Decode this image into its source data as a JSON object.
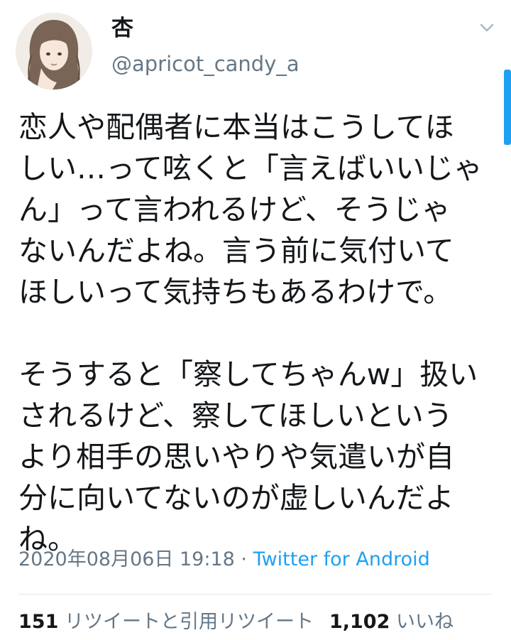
{
  "author": {
    "display_name": "杏",
    "handle": "@apricot_candy_a"
  },
  "tweet": {
    "lines_p1": [
      "恋人や配偶者に本当はこうしてほ",
      "しい…って呟くと「言えばいいじゃ",
      "ん」って言われるけど、そうじゃ",
      "ないんだよね。言う前に気付いて",
      "ほしいって気持ちもあるわけで。"
    ],
    "lines_p2": [
      "そうすると「察してちゃんw」扱い",
      "されるけど、察してほしいという",
      "より相手の思いやりや気遣いが自",
      "分に向いてないのが虚しいんだよ",
      "ね。"
    ]
  },
  "meta": {
    "timestamp": "2020年08月06日 19:18",
    "separator": " · ",
    "source": "Twitter for Android"
  },
  "stats": {
    "retweets_count": "151",
    "retweets_label": "リツイートと引用リツイート",
    "likes_count": "1,102",
    "likes_label": "いいね"
  }
}
